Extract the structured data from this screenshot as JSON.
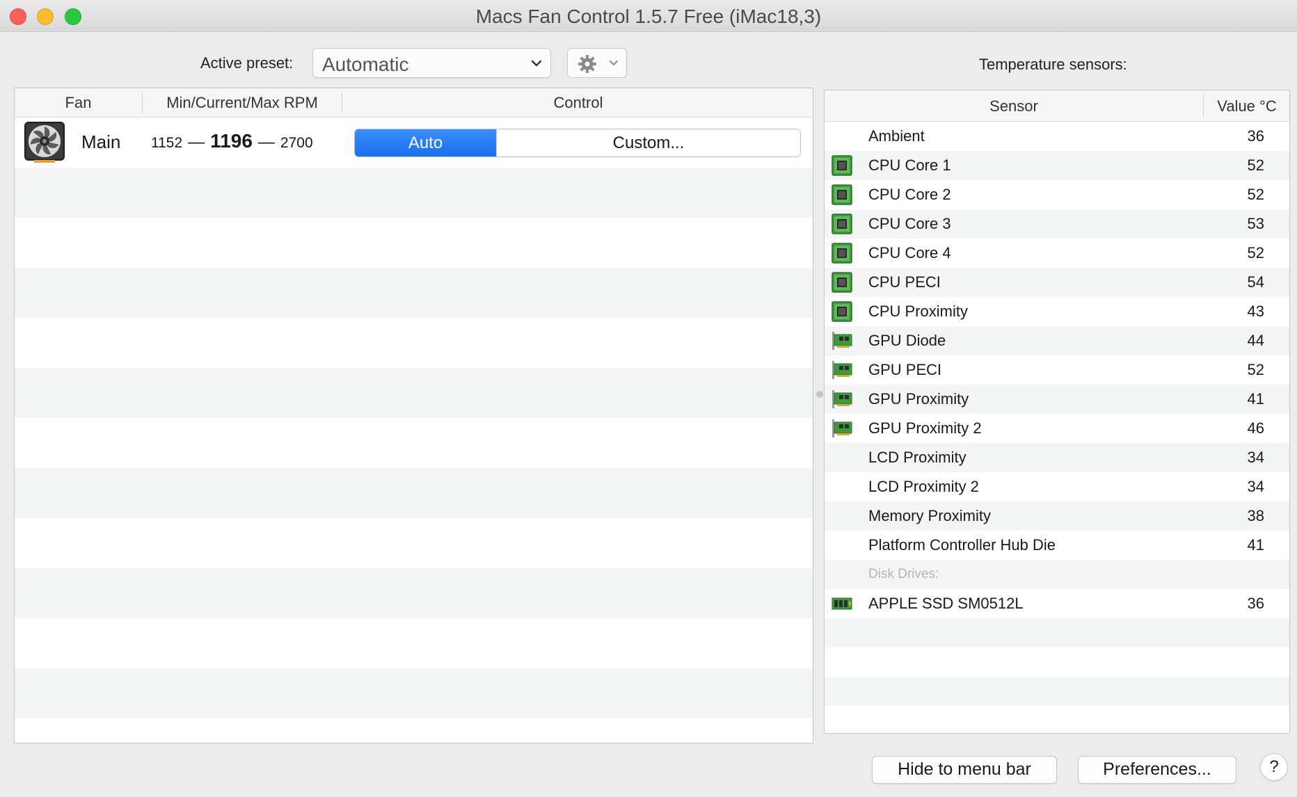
{
  "window": {
    "title": "Macs Fan Control 1.5.7 Free (iMac18,3)"
  },
  "toolbar": {
    "preset_label": "Active preset:",
    "preset_value": "Automatic",
    "temp_heading": "Temperature sensors:"
  },
  "fan_table": {
    "headers": {
      "fan": "Fan",
      "rpm": "Min/Current/Max RPM",
      "control": "Control"
    },
    "fans": [
      {
        "name": "Main",
        "min": "1152",
        "current": "1196",
        "max": "2700",
        "sep": "—",
        "auto_label": "Auto",
        "custom_label": "Custom...",
        "mode": "Auto"
      }
    ]
  },
  "sensor_table": {
    "headers": {
      "sensor": "Sensor",
      "value": "Value °C"
    },
    "rows": [
      {
        "name": "Ambient",
        "value": "36",
        "icon": "none"
      },
      {
        "name": "CPU Core 1",
        "value": "52",
        "icon": "cpu-chip-icon"
      },
      {
        "name": "CPU Core 2",
        "value": "52",
        "icon": "cpu-chip-icon"
      },
      {
        "name": "CPU Core 3",
        "value": "53",
        "icon": "cpu-chip-icon"
      },
      {
        "name": "CPU Core 4",
        "value": "52",
        "icon": "cpu-chip-icon"
      },
      {
        "name": "CPU PECI",
        "value": "54",
        "icon": "cpu-chip-icon"
      },
      {
        "name": "CPU Proximity",
        "value": "43",
        "icon": "cpu-chip-icon"
      },
      {
        "name": "GPU Diode",
        "value": "44",
        "icon": "gpu-card-icon"
      },
      {
        "name": "GPU PECI",
        "value": "52",
        "icon": "gpu-card-icon"
      },
      {
        "name": "GPU Proximity",
        "value": "41",
        "icon": "gpu-card-icon"
      },
      {
        "name": "GPU Proximity 2",
        "value": "46",
        "icon": "gpu-card-icon"
      },
      {
        "name": "LCD Proximity",
        "value": "34",
        "icon": "none"
      },
      {
        "name": "LCD Proximity 2",
        "value": "34",
        "icon": "none"
      },
      {
        "name": "Memory Proximity",
        "value": "38",
        "icon": "none"
      },
      {
        "name": "Platform Controller Hub Die",
        "value": "41",
        "icon": "none"
      }
    ],
    "disk_section_label": "Disk Drives:",
    "disk_rows": [
      {
        "name": "APPLE SSD SM0512L",
        "value": "36",
        "icon": "ssd-icon"
      }
    ]
  },
  "footer": {
    "hide_label": "Hide to menu bar",
    "prefs_label": "Preferences...",
    "help_label": "?"
  }
}
